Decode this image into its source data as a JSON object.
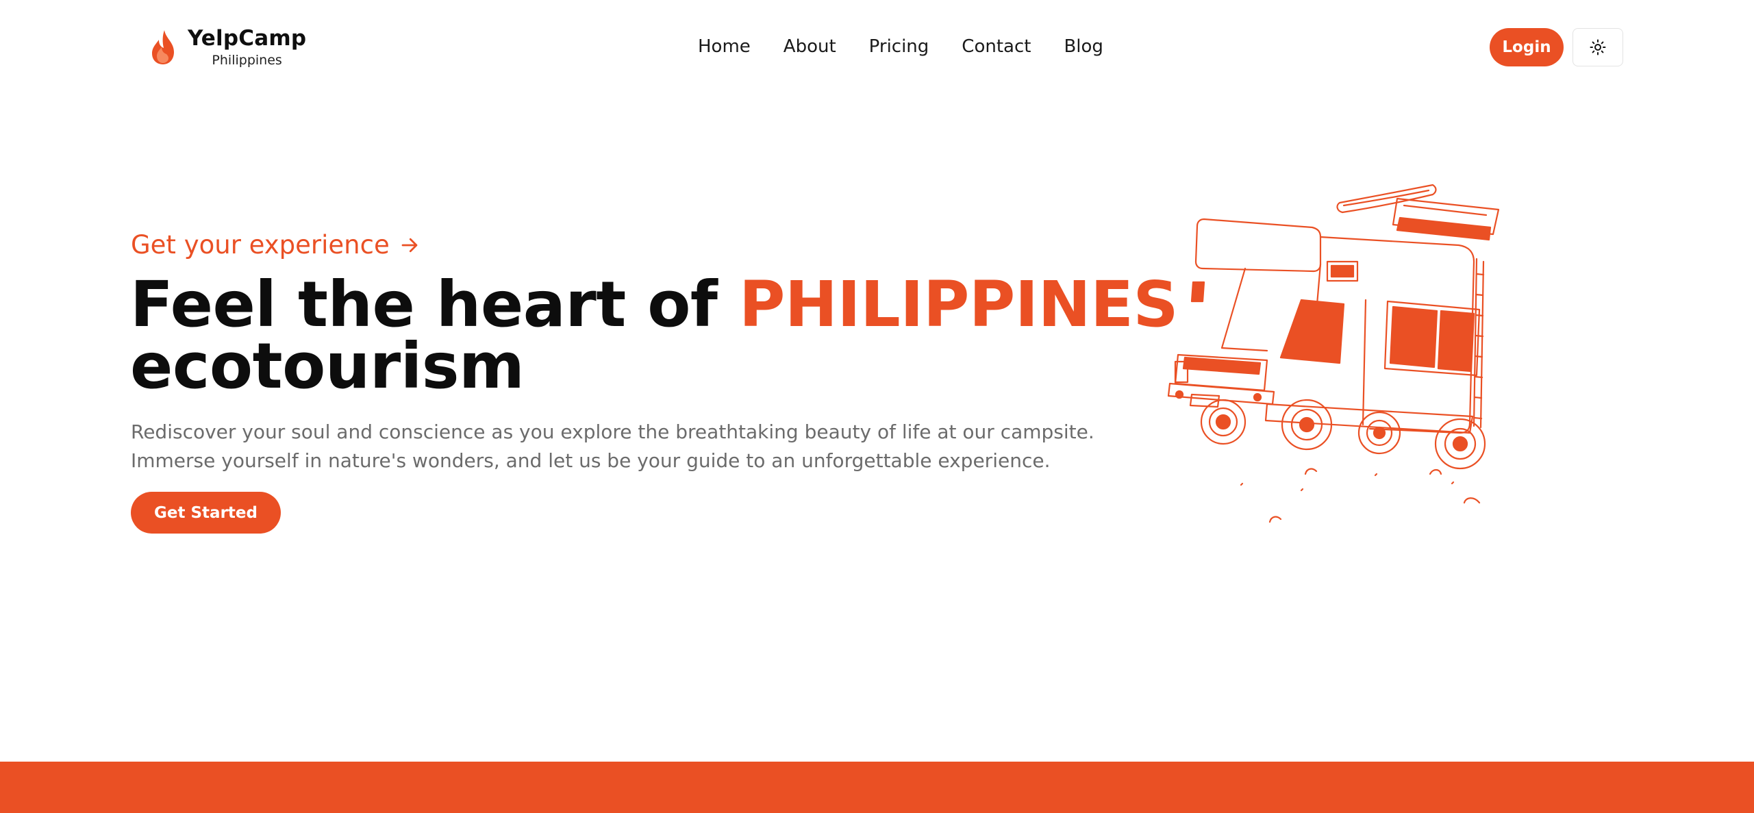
{
  "brand": {
    "name": "YelpCamp",
    "subtitle": "Philippines",
    "icon": "flame-icon"
  },
  "nav": {
    "items": [
      {
        "label": "Home"
      },
      {
        "label": "About"
      },
      {
        "label": "Pricing"
      },
      {
        "label": "Contact"
      },
      {
        "label": "Blog"
      }
    ]
  },
  "header": {
    "login_label": "Login",
    "theme_icon": "sun-icon"
  },
  "hero": {
    "eyebrow": "Get your experience",
    "eyebrow_icon": "arrow-right-icon",
    "headline_line1": "Feel the heart of ",
    "headline_accent": "PHILIPPINES",
    "headline_line2": "ecotourism",
    "lede": "Rediscover your soul and conscience as you explore the breathtaking beauty of life at our campsite. Immerse yourself in nature's wonders, and let us be your guide to an unforgettable experience.",
    "cta_label": "Get Started",
    "illustration": "camper-van-illustration"
  },
  "colors": {
    "accent": "#ea5024",
    "text": "#0d0d0d",
    "muted": "#6b6b6b",
    "background": "#ffffff"
  }
}
